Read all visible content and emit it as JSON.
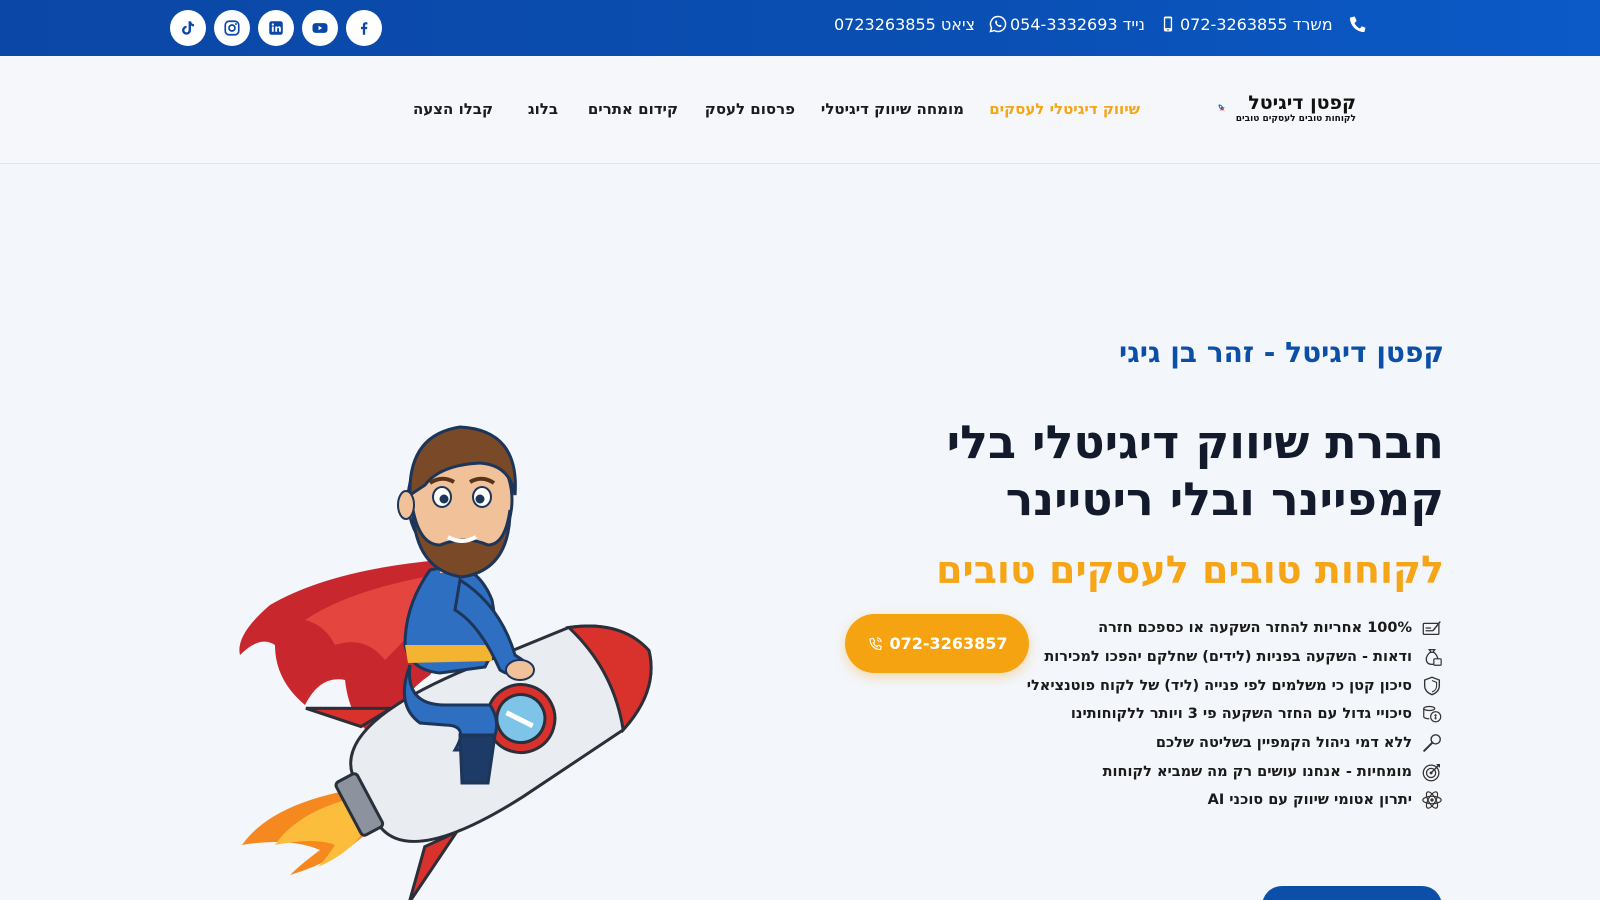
{
  "topbar": {
    "social_icons": [
      "tiktok-icon",
      "instagram-icon",
      "linkedin-icon",
      "youtube-icon",
      "facebook-icon"
    ],
    "whatsapp_text": "ציאט 0723263855",
    "mobile_text": "נייד 054-3332693",
    "office_text": "משרד 072-3263855"
  },
  "nav": {
    "logo_title": "קפטן דיגיטל",
    "logo_tagline": "לקוחות טובים לעסקים טובים",
    "items": [
      {
        "label": "שיווק דיגיטלי לעסקים",
        "active": true
      },
      {
        "label": "מומחה שיווק דיגיטלי"
      },
      {
        "label": "פרסום לעסק"
      },
      {
        "label": "קידום אתרים"
      },
      {
        "label": "בלוג"
      },
      {
        "label": "קבלו הצעה"
      }
    ]
  },
  "hero": {
    "eyebrow": "קפטן דיגיטל - זהר בן גיגי",
    "headline": "חברת שיווק דיגיטלי בלי קמפיינר ובלי ריטיינר",
    "subhead": "לקוחות טובים לעסקים טובים",
    "cta_phone": "072-3263857",
    "features": [
      {
        "icon": "contract-icon",
        "text": "100% אחריות להחזר השקעה או כספכם חזרה"
      },
      {
        "icon": "money-bag-icon",
        "text": "ודאות - השקעה בפניות (לידים) שחלקם יהפכו למכירות"
      },
      {
        "icon": "shield-icon",
        "text": "סיכון קטן כי משלמים לפי פנייה (ליד) של לקוח פוטנציאלי"
      },
      {
        "icon": "coins-icon",
        "text": "סיכויי גדול עם החזר השקעה פי 3 ויותר ללקוחותינו"
      },
      {
        "icon": "wrench-icon",
        "text": "ללא דמי ניהול הקמפיין בשליטה שלכם"
      },
      {
        "icon": "target-icon",
        "text": "מומחיות - אנחנו עושים רק מה שמביא לקוחות"
      },
      {
        "icon": "atom-ai-icon",
        "text": "יתרון אטומי שיווק עם סוכני AI"
      }
    ]
  },
  "colors": {
    "primary_blue": "#0b4fa8",
    "accent_orange": "#f5a516",
    "background": "#f3f6fb"
  }
}
